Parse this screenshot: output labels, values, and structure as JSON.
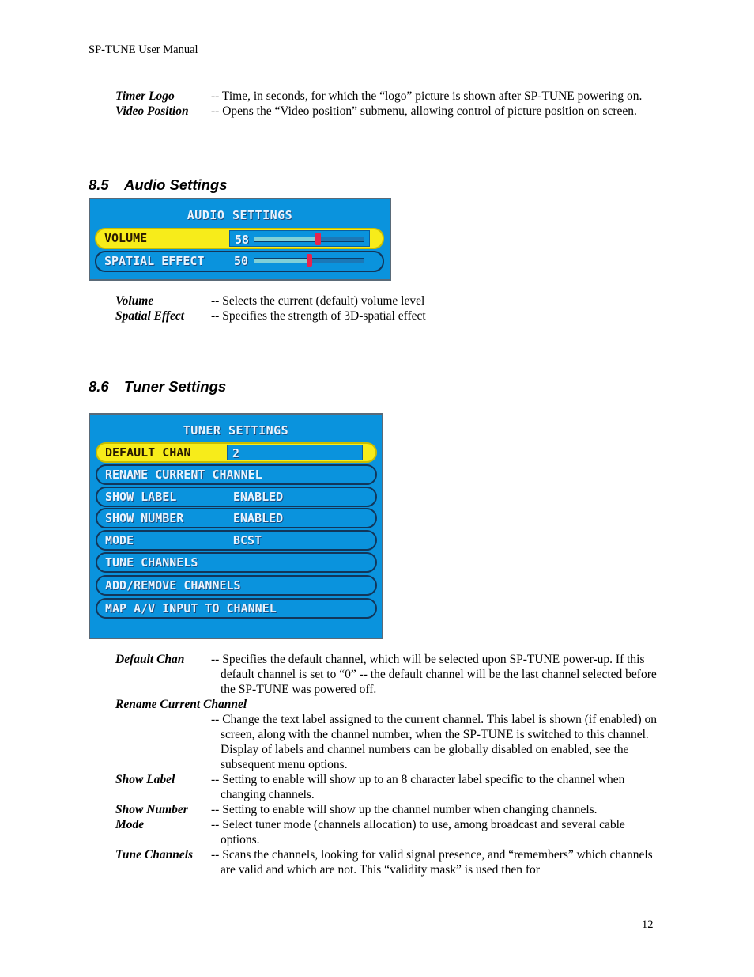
{
  "header": {
    "running_title": "SP-TUNE User Manual"
  },
  "intro_definitions": [
    {
      "term": "Timer Logo",
      "description": "-- Time, in seconds, for which the “logo” picture is shown after SP-TUNE powering on."
    },
    {
      "term": "Video Position",
      "description": "-- Opens the “Video position” submenu, allowing control of picture position on screen."
    }
  ],
  "audio_section": {
    "number": "8.5",
    "title": "Audio Settings",
    "osd": {
      "title": "AUDIO SETTINGS",
      "rows": [
        {
          "label": "VOLUME",
          "value": "58",
          "level": 58,
          "selected": true
        },
        {
          "label": "SPATIAL EFFECT",
          "value": "50",
          "level": 50,
          "selected": false
        }
      ]
    },
    "definitions": [
      {
        "term": "Volume",
        "description": "-- Selects the current (default) volume level"
      },
      {
        "term": "Spatial Effect",
        "description": "-- Specifies the strength of 3D-spatial effect"
      }
    ]
  },
  "tuner_section": {
    "number": "8.6",
    "title": "Tuner Settings",
    "osd": {
      "title": "TUNER SETTINGS",
      "rows": [
        {
          "label": "DEFAULT CHAN",
          "value": "2",
          "selected": true
        },
        {
          "label": "RENAME CURRENT CHANNEL",
          "value": "",
          "selected": false
        },
        {
          "label": "SHOW LABEL",
          "value": "ENABLED",
          "selected": false
        },
        {
          "label": "SHOW NUMBER",
          "value": "ENABLED",
          "selected": false
        },
        {
          "label": "MODE",
          "value": "BCST",
          "selected": false
        },
        {
          "label": "TUNE CHANNELS",
          "value": "",
          "selected": false
        },
        {
          "label": "ADD/REMOVE CHANNELS",
          "value": "",
          "selected": false
        },
        {
          "label": "MAP A/V INPUT TO CHANNEL",
          "value": "",
          "selected": false
        }
      ]
    },
    "definitions": [
      {
        "term": "Default Chan",
        "description": "-- Specifies the default channel, which will be selected upon SP-TUNE power-up. If this default channel is set to “0” -- the default channel will be the last channel selected before the SP-TUNE was powered off."
      },
      {
        "term": "Rename Current Channel",
        "description": "-- Change the text label assigned to the current channel. This label is shown (if enabled) on screen, along with the channel number, when the SP-TUNE is switched to this channel. Display of labels and channel numbers can be globally disabled on enabled, see the subsequent menu options."
      },
      {
        "term": "Show Label",
        "description": "-- Setting to enable will show up to an 8 character label specific to the channel when changing channels."
      },
      {
        "term": "Show Number",
        "description": "-- Setting to enable will show up the channel number when changing channels."
      },
      {
        "term": "Mode",
        "description": "-- Select tuner mode (channels allocation) to use, among broadcast and several cable options."
      },
      {
        "term": "Tune Channels",
        "description": "-- Scans the channels, looking for valid signal presence, and “remembers” which channels are valid and which are not. This “validity mask” is used then for"
      }
    ]
  },
  "footer": {
    "page_number": "12"
  },
  "colors": {
    "osd_blue": "#0a93dd",
    "highlight_yellow": "#f7ec1a",
    "slider_thumb": "#e8244e"
  }
}
